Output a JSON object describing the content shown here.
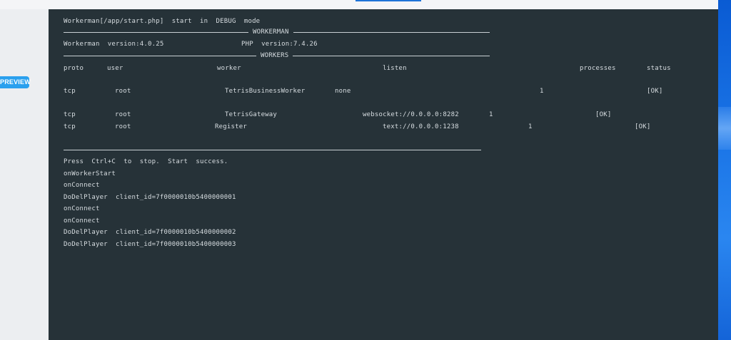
{
  "preview_badge": "PREVIEW",
  "header_line": "Workerman[/app/start.php]  start  in  DEBUG  mode",
  "section_workerman": "WORKERMAN",
  "workerman_version": "Workerman  version:4.0.25",
  "php_version": "PHP  version:7.4.26",
  "section_workers": "WORKERS",
  "columns": {
    "proto": "proto",
    "user": "user",
    "worker": "worker",
    "listen": "listen",
    "processes": "processes",
    "status": "status"
  },
  "workers": [
    {
      "proto": "tcp",
      "user": "root",
      "worker": "TetrisBusinessWorker",
      "listen": "none",
      "processes": "1",
      "status": "[OK]"
    },
    {
      "proto": "tcp",
      "user": "root",
      "worker": "TetrisGateway",
      "listen": "websocket://0.0.0.0:8282",
      "processes": "1",
      "status": "[OK]"
    },
    {
      "proto": "tcp",
      "user": "root",
      "worker": "Register",
      "listen": "text://0.0.0.0:1238",
      "processes": "1",
      "status": "[OK]"
    }
  ],
  "log": [
    "Press  Ctrl+C  to  stop.  Start  success.",
    "onWorkerStart",
    "onConnect",
    "DoDelPlayer  client_id=7f0000010b5400000001",
    "onConnect",
    "onConnect",
    "DoDelPlayer  client_id=7f0000010b5400000002",
    "DoDelPlayer  client_id=7f0000010b5400000003"
  ]
}
